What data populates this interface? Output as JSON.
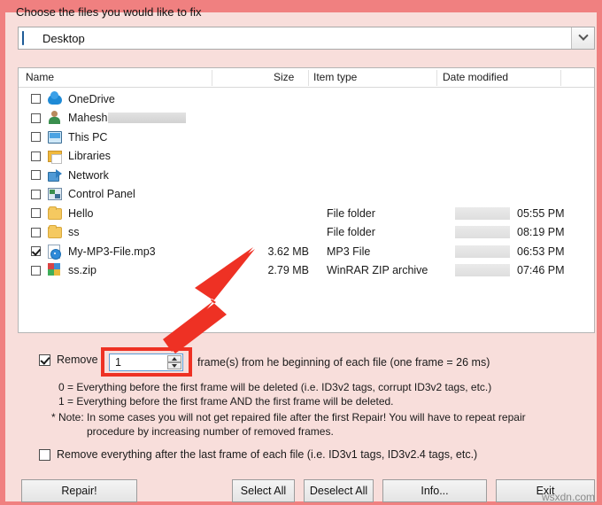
{
  "dialog": {
    "title": "Choose the files you would like to fix",
    "location": {
      "value": "Desktop",
      "icon": "desktop-icon"
    }
  },
  "file_list": {
    "columns": [
      "Name",
      "Size",
      "Item type",
      "Date modified"
    ],
    "rows": [
      {
        "checked": false,
        "icon": "onedrive-cloud-icon",
        "name": "OneDrive",
        "redacted_name": false,
        "size": "",
        "type": "",
        "date_redacted": false,
        "time": ""
      },
      {
        "checked": false,
        "icon": "user-icon",
        "name": "Mahesh",
        "redacted_name": true,
        "size": "",
        "type": "",
        "date_redacted": false,
        "time": ""
      },
      {
        "checked": false,
        "icon": "this-pc-icon",
        "name": "This PC",
        "redacted_name": false,
        "size": "",
        "type": "",
        "date_redacted": false,
        "time": ""
      },
      {
        "checked": false,
        "icon": "libraries-icon",
        "name": "Libraries",
        "redacted_name": false,
        "size": "",
        "type": "",
        "date_redacted": false,
        "time": ""
      },
      {
        "checked": false,
        "icon": "network-icon",
        "name": "Network",
        "redacted_name": false,
        "size": "",
        "type": "",
        "date_redacted": false,
        "time": ""
      },
      {
        "checked": false,
        "icon": "control-panel-icon",
        "name": "Control Panel",
        "redacted_name": false,
        "size": "",
        "type": "",
        "date_redacted": false,
        "time": ""
      },
      {
        "checked": false,
        "icon": "folder-icon",
        "name": "Hello",
        "redacted_name": false,
        "size": "",
        "type": "File folder",
        "date_redacted": true,
        "time": "05:55 PM"
      },
      {
        "checked": false,
        "icon": "folder-icon",
        "name": "ss",
        "redacted_name": false,
        "size": "",
        "type": "File folder",
        "date_redacted": true,
        "time": "08:19 PM"
      },
      {
        "checked": true,
        "icon": "mp3-file-icon",
        "name": "My-MP3-File.mp3",
        "redacted_name": false,
        "size": "3.62 MB",
        "type": "MP3 File",
        "date_redacted": true,
        "time": "06:53 PM"
      },
      {
        "checked": false,
        "icon": "zip-archive-icon",
        "name": "ss.zip",
        "redacted_name": false,
        "size": "2.79 MB",
        "type": "WinRAR ZIP archive",
        "date_redacted": true,
        "time": "07:46 PM"
      }
    ]
  },
  "options": {
    "remove_frames": {
      "checked": true,
      "label_before": "Remove",
      "value": "1",
      "label_after": "frame(s) from he beginning of each file (one frame = 26 ms)"
    },
    "help_lines": [
      "0 = Everything before the first frame will be deleted (i.e. ID3v2 tags, corrupt ID3v2 tags, etc.)",
      "1 = Everything before the first frame AND the first frame will be deleted.",
      "* Note: In some cases you will not get repaired file after the first Repair! You will have to repeat repair",
      "procedure by increasing number of removed frames."
    ],
    "remove_after_last": {
      "checked": false,
      "label": "Remove everything after the last frame of each file (i.e. ID3v1 tags, ID3v2.4 tags, etc.)"
    }
  },
  "buttons": {
    "repair": "Repair!",
    "select_all": "Select All",
    "deselect_all": "Deselect All",
    "info": "Info...",
    "exit": "Exit"
  },
  "annotation": {
    "arrow": "red-arrow-pointing-to-spinner",
    "highlight_color": "#ee3124"
  },
  "watermark": "wsxdn.com"
}
